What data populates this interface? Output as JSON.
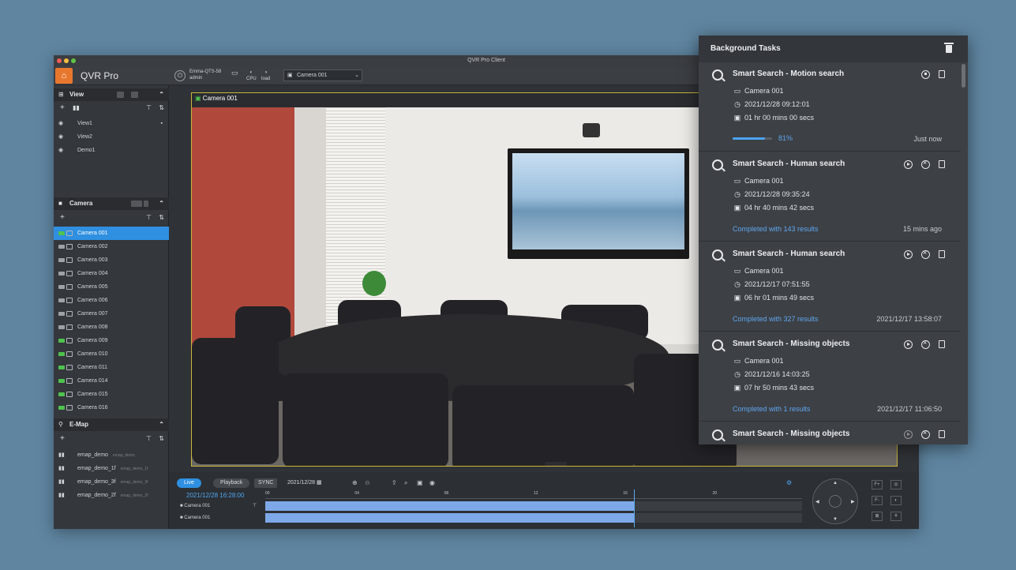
{
  "window": {
    "title": "QVR Pro Client",
    "app_name": "QVR Pro"
  },
  "toolbar": {
    "server_name": "Emma-QTS-58",
    "user": "admin",
    "cpu_label": "CPU",
    "load_label": "load",
    "camera_select": "Camera 001"
  },
  "sidebar": {
    "view": {
      "title": "View",
      "items": [
        "View1",
        "View2",
        "Demo1"
      ]
    },
    "camera": {
      "title": "Camera",
      "items": [
        {
          "label": "Camera 001",
          "status": "green",
          "selected": true
        },
        {
          "label": "Camera 002",
          "status": "gray"
        },
        {
          "label": "Camera 003",
          "status": "gray"
        },
        {
          "label": "Camera 004",
          "status": "gray"
        },
        {
          "label": "Camera 005",
          "status": "gray"
        },
        {
          "label": "Camera 006",
          "status": "gray"
        },
        {
          "label": "Camera 007",
          "status": "gray"
        },
        {
          "label": "Camera 008",
          "status": "gray"
        },
        {
          "label": "Camera 009",
          "status": "green"
        },
        {
          "label": "Camera 010",
          "status": "green"
        },
        {
          "label": "Camera 011",
          "status": "green"
        },
        {
          "label": "Camera 014",
          "status": "green"
        },
        {
          "label": "Camera 015",
          "status": "green"
        },
        {
          "label": "Camera 016",
          "status": "green"
        }
      ]
    },
    "emap": {
      "title": "E-Map",
      "items": [
        {
          "label": "emap_demo",
          "sub": "emap_demo"
        },
        {
          "label": "emap_demo_1f",
          "sub": "emap_demo_1f"
        },
        {
          "label": "emap_demo_3f",
          "sub": "emap_demo_3f"
        },
        {
          "label": "emap_demo_2f",
          "sub": "emap_demo_2f"
        }
      ]
    }
  },
  "viewport": {
    "camera_label": "Camera 001"
  },
  "timeline": {
    "live_label": "Live",
    "playback_label": "Playback",
    "sync_label": "SYNC",
    "date": "2021/12/28",
    "current_time": "2021/12/28 16:28:00",
    "ticks": [
      "00",
      "04",
      "08",
      "12",
      "16",
      "20"
    ],
    "tracks": [
      "Camera 001",
      "Camera 001"
    ],
    "recorded_until_hour": 16.47
  },
  "tasks_panel": {
    "title": "Background Tasks",
    "tasks": [
      {
        "title": "Smart Search - Motion search",
        "camera": "Camera 001",
        "datetime": "2021/12/28  09:12:01",
        "duration": "01 hr 00 mins 00 secs",
        "progress": 81,
        "progress_label": "81%",
        "time": "Just now",
        "actions": [
          "stop",
          "log"
        ]
      },
      {
        "title": "Smart Search - Human search",
        "camera": "Camera 001",
        "datetime": "2021/12/28  09:35:24",
        "duration": "04 hr 40 mins 42 secs",
        "status": "Completed with 143 results",
        "time": "15 mins ago",
        "actions": [
          "play",
          "cancel",
          "log"
        ]
      },
      {
        "title": "Smart Search - Human search",
        "camera": "Camera 001",
        "datetime": "2021/12/17  07:51:55",
        "duration": "06 hr 01 mins 49 secs",
        "status": "Completed with 327 results",
        "time": "2021/12/17 13:58:07",
        "actions": [
          "play",
          "cancel",
          "log"
        ]
      },
      {
        "title": "Smart Search - Missing objects",
        "camera": "Camera 001",
        "datetime": "2021/12/16  14:03:25",
        "duration": "07 hr 50 mins 43 secs",
        "status": "Completed with 1 results",
        "time": "2021/12/17 11:06:50",
        "actions": [
          "play",
          "cancel",
          "log"
        ]
      },
      {
        "title": "Smart Search - Missing objects",
        "actions": [
          "play-disabled",
          "cancel",
          "log"
        ]
      }
    ]
  }
}
